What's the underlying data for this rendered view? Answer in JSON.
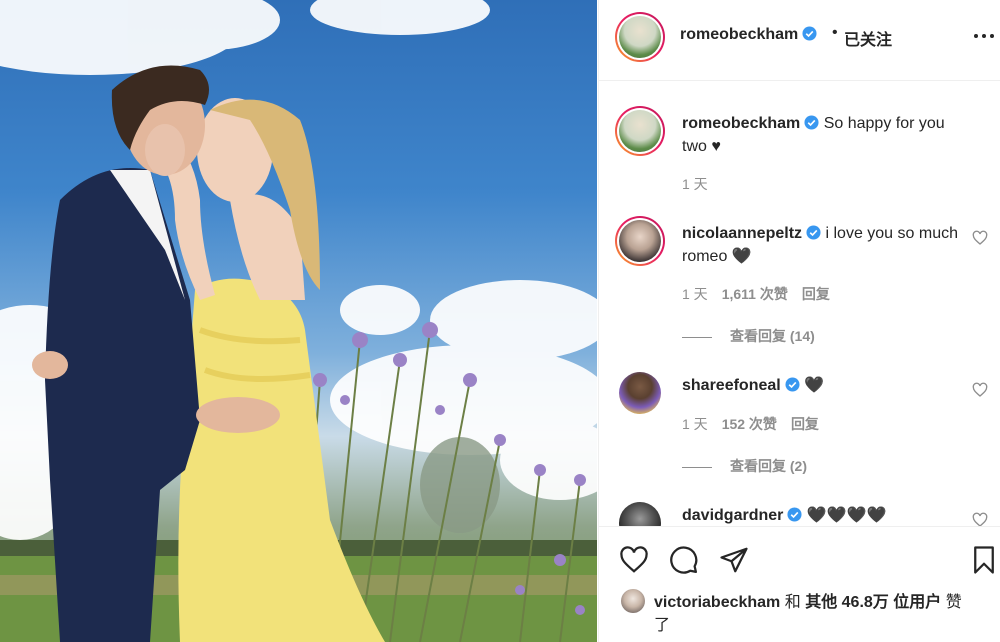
{
  "post_author": {
    "username": "romeobeckham",
    "separator": "•",
    "follow_status": "已关注",
    "more_icon": "more-options-icon"
  },
  "comments": [
    {
      "username": "romeobeckham",
      "text": "So happy for you two ♥",
      "time": "1 天"
    },
    {
      "username": "nicolaannepeltz",
      "text": "i love you so much romeo 🖤",
      "time": "1 天",
      "likes": "1,611 次赞",
      "reply": "回复",
      "view_replies": "查看回复 (14)"
    },
    {
      "username": "shareefoneal",
      "text": "🖤",
      "time": "1 天",
      "likes": "152 次赞",
      "reply": "回复",
      "view_replies": "查看回复 (2)"
    },
    {
      "username": "davidgardner",
      "text": "🖤🖤🖤🖤"
    }
  ],
  "actions": {
    "like_icon": "heart-icon",
    "comment_icon": "comment-icon",
    "share_icon": "send-icon",
    "save_icon": "bookmark-icon"
  },
  "liked_by": {
    "user": "victoriabeckham",
    "and": "和",
    "others": "其他 46.8万 位用户",
    "suffix": "赞了"
  },
  "colors": {
    "verified": "#3897f0",
    "story_ring_start": "#f9a825",
    "story_ring_end": "#c2185b",
    "secondary_text": "#8e8e8e"
  }
}
